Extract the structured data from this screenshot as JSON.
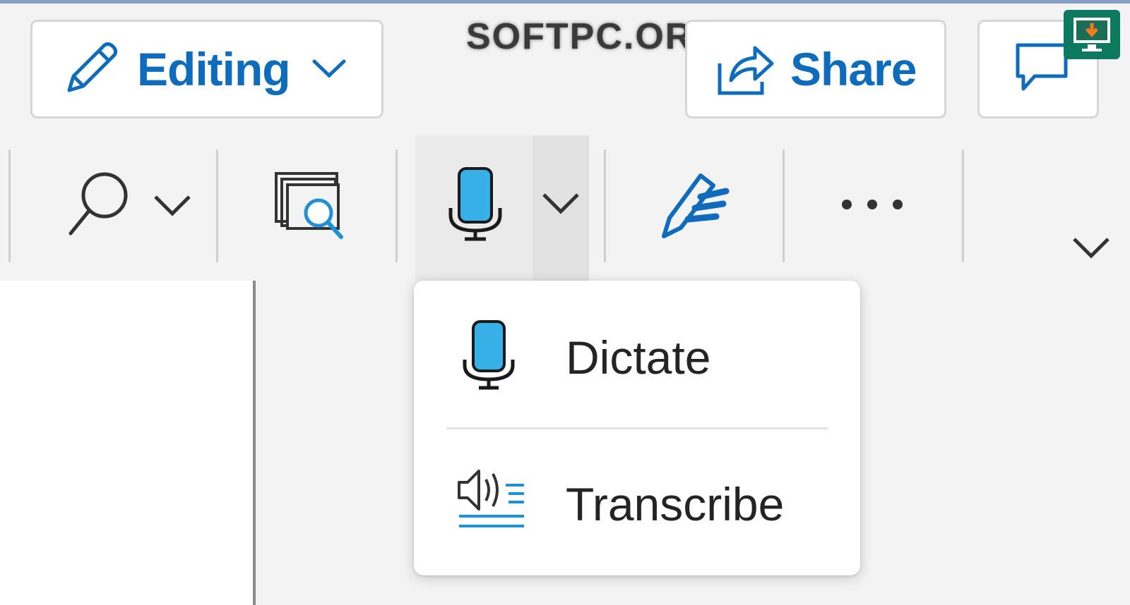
{
  "header": {
    "editing_label": "Editing",
    "share_label": "Share"
  },
  "watermark": "SOFTPC.ORG",
  "toolbar": {
    "icons": [
      "search-icon",
      "find-window-icon",
      "microphone-icon",
      "editor-pen-icon",
      "more-icon",
      "expand-ribbon-icon"
    ]
  },
  "dictate_menu": {
    "items": [
      {
        "label": "Dictate",
        "icon": "microphone-icon"
      },
      {
        "label": "Transcribe",
        "icon": "transcribe-icon"
      }
    ]
  },
  "colors": {
    "accent": "#0f6cbd",
    "mic_fill": "#37b0e8",
    "badge": "#0d7a5f"
  }
}
